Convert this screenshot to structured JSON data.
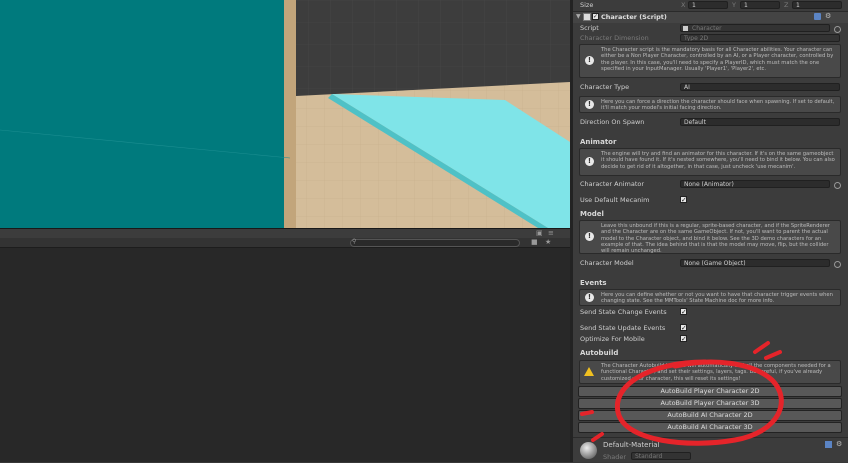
{
  "inspector": {
    "size_label": "Size",
    "size_x_label": "X",
    "size_x": "1",
    "size_y_label": "Y",
    "size_y": "1",
    "size_z_label": "Z",
    "size_z": "1",
    "component_title": "Character (Script)",
    "script_label": "Script",
    "script_value": "Character",
    "dimension_label": "Character Dimension",
    "dimension_value": "Type 2D",
    "help_script": "The Character script is the mandatory basis for all Character abilities. Your character can either be a Non Player Character, controlled by an AI, or a Player character, controlled by the player. In this case, you'll need to specify a PlayerID, which must match the one specified in your InputManager. Usually 'Player1', 'Player2', etc.",
    "type_label": "Character Type",
    "type_value": "AI",
    "help_direction": "Here you can force a direction the character should face when spawning. If set to default, it'll match your model's initial facing direction.",
    "direction_label": "Direction On Spawn",
    "direction_value": "Default",
    "animator_section": "Animator",
    "help_animator": "The engine will try and find an animator for this character. If it's on the same gameobject it should have found it. If it's nested somewhere, you'll need to bind it below. You can also decide to get rid of it altogether, in that case, just uncheck 'use mecanim'.",
    "animator_label": "Character Animator",
    "animator_value": "None (Animator)",
    "mecanim_label": "Use Default Mecanim",
    "model_section": "Model",
    "help_model": "Leave this unbound if this is a regular, sprite-based character, and if the SpriteRenderer and the Character are on the same GameObject. If not, you'll want to parent the actual model to the Character object, and bind it below. See the 3D demo characters for an example of that. The idea behind that is that the model may move, flip, but the collider will remain unchanged.",
    "model_label": "Character Model",
    "model_value": "None (Game Object)",
    "events_section": "Events",
    "help_events": "Here you can define whether or not you want to have that character trigger events when changing state. See the MMTools' State Machine doc for more info.",
    "send_change_label": "Send State Change Events",
    "send_update_label": "Send State Update Events",
    "optimize_label": "Optimize For Mobile",
    "autobuild_section": "Autobuild",
    "help_autobuild": "The Character Autobuild buttons will automatically add all the components needed for a functional Character, and set their settings, layers, tags. Be careful, if you've already customized your character, this will reset its settings!",
    "btn_player_2d": "AutoBuild Player Character 2D",
    "btn_player_3d": "AutoBuild Player Character 3D",
    "btn_ai_2d": "AutoBuild AI Character 2D",
    "btn_ai_3d": "AutoBuild AI Character 3D",
    "material_name": "Default-Material",
    "shader_label": "Shader",
    "shader_value": "Standard"
  },
  "colors": {
    "teal_wall": "#007a7d",
    "cyan_ramp": "#7fe4e8",
    "sand_floor": "#d4bd9a",
    "annotation_red": "#e5242a"
  }
}
